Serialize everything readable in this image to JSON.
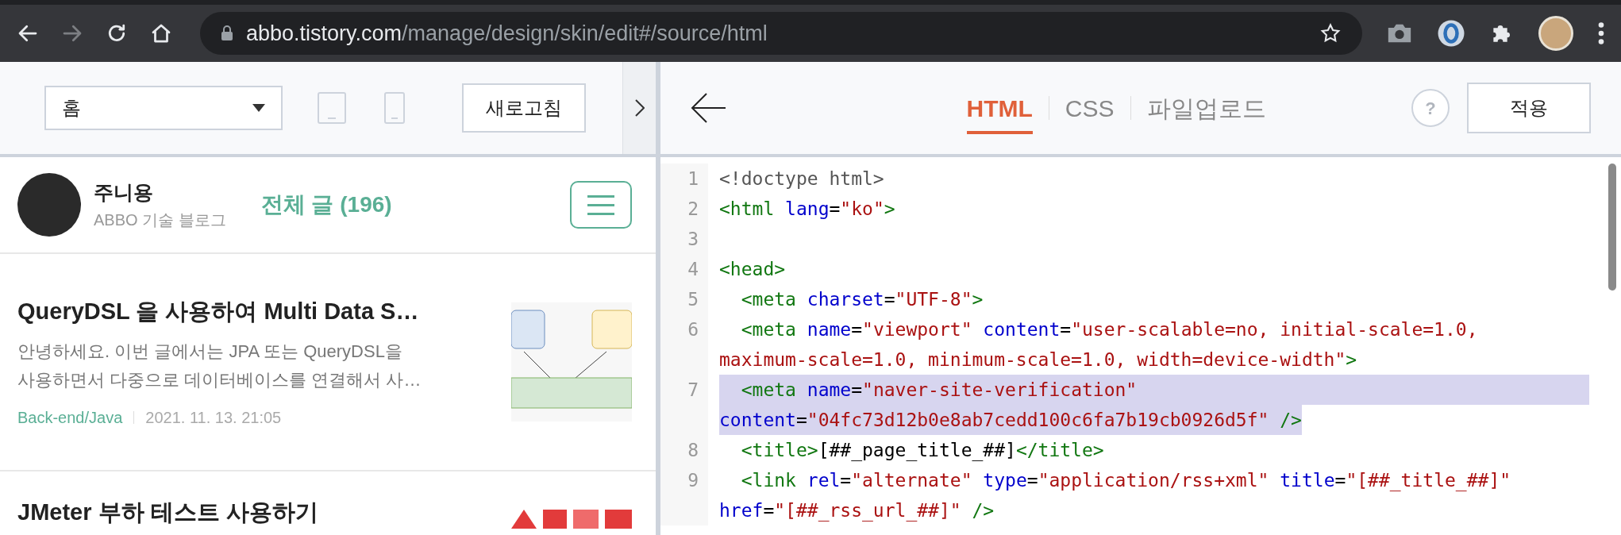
{
  "browser": {
    "nav": [
      {
        "kind": "back",
        "disabled": false
      },
      {
        "kind": "forward",
        "disabled": true
      },
      {
        "kind": "reload",
        "disabled": false
      },
      {
        "kind": "home",
        "disabled": false
      }
    ],
    "url_host": "abbo.tistory.com",
    "url_path": "/manage/design/skin/edit#/source/html"
  },
  "preview": {
    "page_select": "홈",
    "refresh_button": "새로고침",
    "blog": {
      "name": "주니용",
      "subtitle": "ABBO 기술 블로그",
      "post_count": "전체 글 (196)"
    },
    "posts": [
      {
        "title": "QueryDSL 을 사용하여 Multi Data S…",
        "excerpt_lines": [
          "안녕하세요. 이번 글에서는 JPA 또는 QueryDSL을",
          "사용하면서 다중으로 데이터베이스를 연결해서 사…"
        ],
        "category": "Back-end/Java",
        "date": "2021. 11. 13. 21:05"
      },
      {
        "title": "JMeter 부하 테스트 사용하기"
      }
    ]
  },
  "editor": {
    "tabs": [
      {
        "label": "HTML",
        "selected": true
      },
      {
        "label": "CSS",
        "selected": false
      },
      {
        "label": "파일업로드",
        "selected": false
      }
    ],
    "help": "?",
    "apply_button": "적용",
    "lines": [
      {
        "number": "1",
        "highlighted": false,
        "rows": [
          {
            "tokens": [
              {
                "kind": "plain",
                "text": "<!doctype html>"
              }
            ]
          }
        ]
      },
      {
        "number": "2",
        "highlighted": false,
        "rows": [
          {
            "tokens": [
              {
                "kind": "tag",
                "text": "<html "
              },
              {
                "kind": "attr",
                "text": "lang"
              },
              {
                "kind": "text",
                "text": "="
              },
              {
                "kind": "string",
                "text": "\"ko\""
              },
              {
                "kind": "tag",
                "text": ">"
              }
            ]
          }
        ]
      },
      {
        "number": "3",
        "highlighted": false,
        "rows": [
          {
            "tokens": []
          }
        ]
      },
      {
        "number": "4",
        "highlighted": false,
        "rows": [
          {
            "tokens": [
              {
                "kind": "tag",
                "text": "<head>"
              }
            ]
          }
        ]
      },
      {
        "number": "5",
        "highlighted": false,
        "rows": [
          {
            "tokens": [
              {
                "kind": "tag",
                "text": "  <meta "
              },
              {
                "kind": "attr",
                "text": "charset"
              },
              {
                "kind": "text",
                "text": "="
              },
              {
                "kind": "string",
                "text": "\"UTF-8\""
              },
              {
                "kind": "tag",
                "text": ">"
              }
            ]
          }
        ]
      },
      {
        "number": "6",
        "highlighted": false,
        "rows": [
          {
            "tokens": [
              {
                "kind": "tag",
                "text": "  <meta "
              },
              {
                "kind": "attr",
                "text": "name"
              },
              {
                "kind": "text",
                "text": "="
              },
              {
                "kind": "string",
                "text": "\"viewport\""
              },
              {
                "kind": "attr",
                "text": " content"
              },
              {
                "kind": "text",
                "text": "="
              },
              {
                "kind": "string",
                "text": "\"user-scalable=no, initial-scale=1.0,"
              }
            ]
          },
          {
            "tokens": [
              {
                "kind": "string",
                "text": "maximum-scale=1.0, minimum-scale=1.0, width=device-width\""
              },
              {
                "kind": "tag",
                "text": ">"
              }
            ]
          }
        ]
      },
      {
        "number": "7",
        "highlighted": true,
        "rows": [
          {
            "tokens": [
              {
                "kind": "tag",
                "text": "  <meta "
              },
              {
                "kind": "attr",
                "text": "name"
              },
              {
                "kind": "text",
                "text": "="
              },
              {
                "kind": "string",
                "text": "\"naver-site-verification\""
              }
            ]
          },
          {
            "tokens": [
              {
                "kind": "attr",
                "text": "content"
              },
              {
                "kind": "text",
                "text": "="
              },
              {
                "kind": "string",
                "text": "\"04fc73d12b0e8ab7cedd100c6fa7b19cb0926d5f\""
              },
              {
                "kind": "tag",
                "text": " />"
              }
            ]
          }
        ]
      },
      {
        "number": "8",
        "highlighted": false,
        "rows": [
          {
            "tokens": [
              {
                "kind": "tag",
                "text": "  <title>"
              },
              {
                "kind": "text",
                "text": "[##_page_title_##]"
              },
              {
                "kind": "tag",
                "text": "</title>"
              }
            ]
          }
        ]
      },
      {
        "number": "9",
        "highlighted": false,
        "rows": [
          {
            "tokens": [
              {
                "kind": "tag",
                "text": "  <link "
              },
              {
                "kind": "attr",
                "text": "rel"
              },
              {
                "kind": "text",
                "text": "="
              },
              {
                "kind": "string",
                "text": "\"alternate\""
              },
              {
                "kind": "attr",
                "text": " type"
              },
              {
                "kind": "text",
                "text": "="
              },
              {
                "kind": "string",
                "text": "\"application/rss+xml\""
              },
              {
                "kind": "attr",
                "text": " title"
              },
              {
                "kind": "text",
                "text": "="
              },
              {
                "kind": "string",
                "text": "\"[##_title_##]\""
              }
            ]
          },
          {
            "tokens": [
              {
                "kind": "attr",
                "text": "href"
              },
              {
                "kind": "text",
                "text": "="
              },
              {
                "kind": "string",
                "text": "\"[##_rss_url_##]\""
              },
              {
                "kind": "tag",
                "text": " />"
              }
            ]
          }
        ]
      }
    ]
  }
}
